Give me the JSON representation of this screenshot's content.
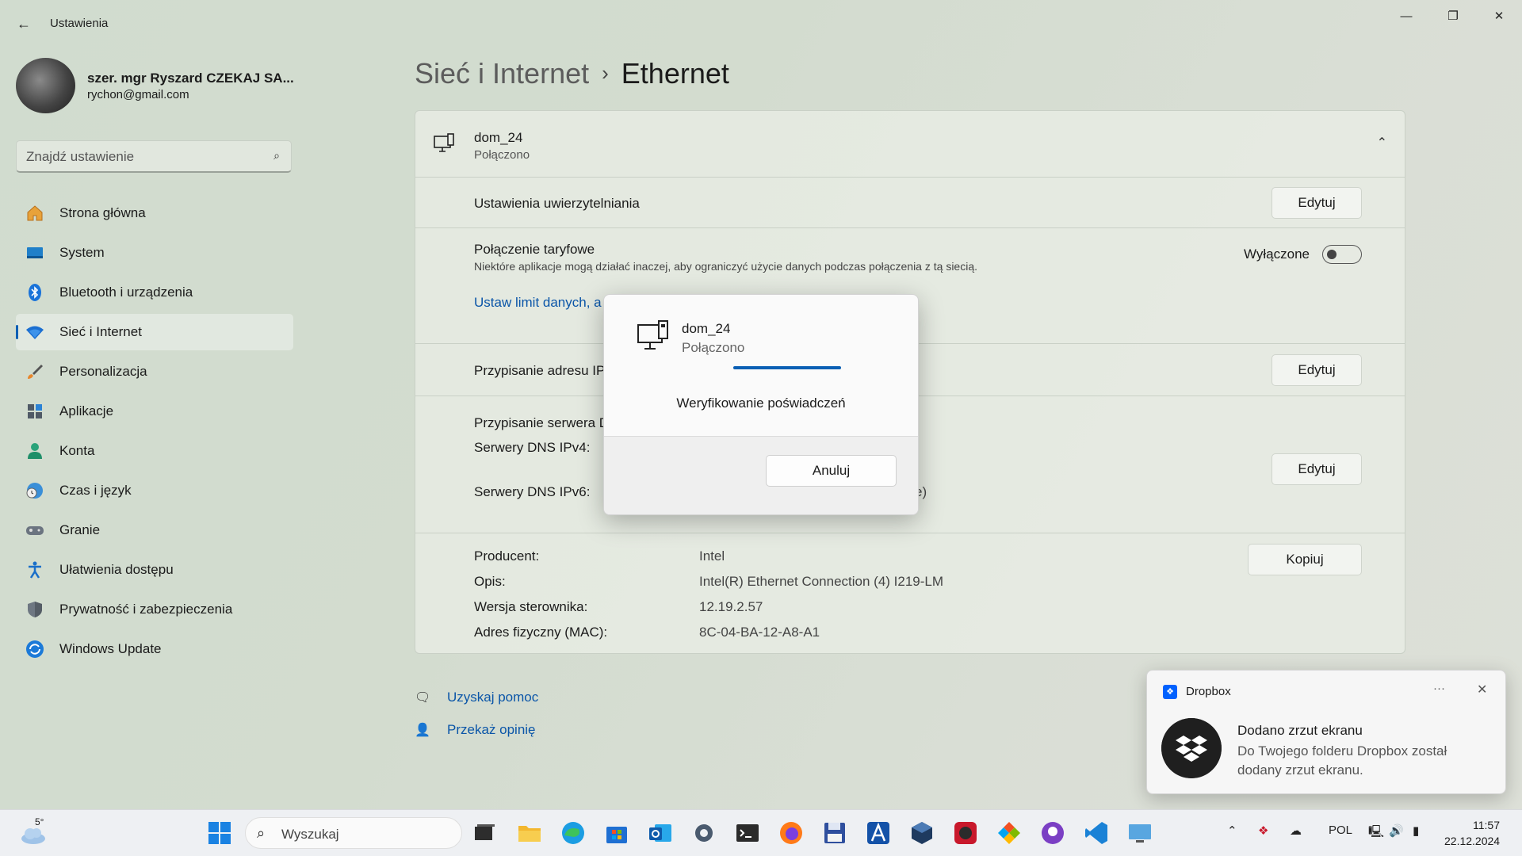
{
  "window": {
    "title": "Ustawienia",
    "back_icon": "back-arrow-icon",
    "controls": {
      "minimize": "—",
      "maximize": "❐",
      "close": "✕"
    }
  },
  "profile": {
    "name": "szer. mgr Ryszard CZEKAJ SA...",
    "email": "rychon@gmail.com"
  },
  "search": {
    "placeholder": "Znajdź ustawienie"
  },
  "nav": {
    "items": [
      {
        "label": "Strona główna",
        "icon": "home-icon"
      },
      {
        "label": "System",
        "icon": "system-icon"
      },
      {
        "label": "Bluetooth i urządzenia",
        "icon": "bluetooth-icon"
      },
      {
        "label": "Sieć i Internet",
        "icon": "wifi-icon",
        "active": true
      },
      {
        "label": "Personalizacja",
        "icon": "brush-icon"
      },
      {
        "label": "Aplikacje",
        "icon": "apps-icon"
      },
      {
        "label": "Konta",
        "icon": "account-icon"
      },
      {
        "label": "Czas i język",
        "icon": "clock-globe-icon"
      },
      {
        "label": "Granie",
        "icon": "gamepad-icon"
      },
      {
        "label": "Ułatwienia dostępu",
        "icon": "accessibility-icon"
      },
      {
        "label": "Prywatność i zabezpieczenia",
        "icon": "shield-icon"
      },
      {
        "label": "Windows Update",
        "icon": "update-icon"
      }
    ]
  },
  "breadcrumb": {
    "parent": "Sieć i Internet",
    "separator": "›",
    "current": "Ethernet"
  },
  "network": {
    "name": "dom_24",
    "status": "Połączono",
    "auth_label": "Ustawienia uwierzytelniania",
    "auth_button": "Edytuj",
    "metered_label": "Połączenie taryfowe",
    "metered_desc": "Niektóre aplikacje mogą działać inaczej, aby ograniczyć użycie danych podczas połączenia z tą siecią.",
    "metered_state": "Wyłączone",
    "metered_on": false,
    "data_limit_link": "Ustaw limit danych, a",
    "ip_label": "Przypisanie adresu IP",
    "ip_button": "Edytuj",
    "dns_label": "Przypisanie serwera D",
    "dns_ipv4_label": "Serwery DNS IPv4:",
    "dns_ipv6_label": "Serwery DNS IPv6:",
    "dns_ipv6_partial": "e)",
    "dns_button": "Edytuj",
    "properties": [
      {
        "label": "Producent:",
        "value": "Intel"
      },
      {
        "label": "Opis:",
        "value": "Intel(R) Ethernet Connection (4) I219-LM"
      },
      {
        "label": "Wersja sterownika:",
        "value": "12.19.2.57"
      },
      {
        "label": "Adres fizyczny (MAC):",
        "value": "8C-04-BA-12-A8-A1"
      }
    ],
    "copy_button": "Kopiuj"
  },
  "help": {
    "get_help": "Uzyskaj pomoc",
    "feedback": "Przekaż opinię"
  },
  "dialog": {
    "name": "dom_24",
    "status": "Połączono",
    "message": "Weryfikowanie poświadczeń",
    "cancel": "Anuluj"
  },
  "toast": {
    "app": "Dropbox",
    "more": "···",
    "close": "✕",
    "title": "Dodano zrzut ekranu",
    "body": "Do Twojego folderu Dropbox został dodany zrzut ekranu."
  },
  "taskbar": {
    "weather_temp": "5°",
    "search_placeholder": "Wyszukaj",
    "language": "POL",
    "time": "11:57",
    "date": "22.12.2024",
    "apps": [
      "start-icon",
      "task-view-icon",
      "file-explorer-icon",
      "edge-icon",
      "store-icon",
      "outlook-icon",
      "settings-icon",
      "terminal-icon",
      "firefox-icon",
      "save-app-icon",
      "app-a-icon",
      "virtualbox-icon",
      "app-red-icon",
      "app-gems-icon",
      "github-icon",
      "vscode-icon",
      "remote-desktop-icon"
    ]
  },
  "colors": {
    "accent": "#0a5fb4",
    "link": "#0a55a8",
    "dropbox": "#0061fe"
  }
}
